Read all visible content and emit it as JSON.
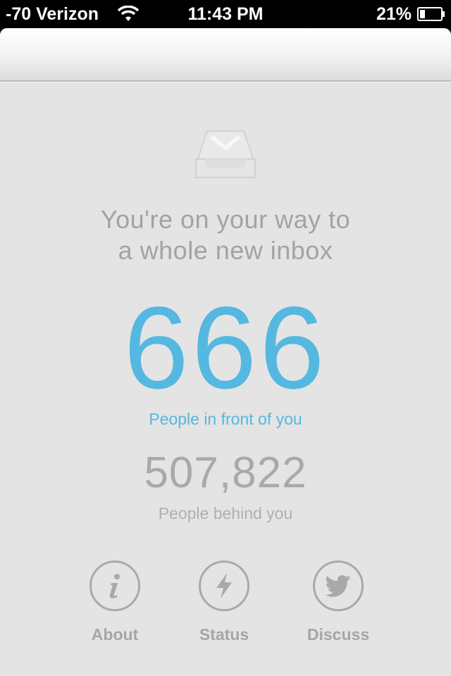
{
  "status_bar": {
    "carrier": "-70 Verizon",
    "time": "11:43 PM",
    "battery_percent": "21%",
    "wifi_icon": "wifi-icon",
    "battery_icon": "battery-icon"
  },
  "main": {
    "logo_icon": "mailbox-tray-icon",
    "tagline_line1": "You're on your way to",
    "tagline_line2": "a whole new inbox",
    "ahead_count": "666",
    "ahead_label": "People in front of you",
    "behind_count": "507,822",
    "behind_label": "People behind you"
  },
  "actions": [
    {
      "label": "About",
      "icon": "info-icon"
    },
    {
      "label": "Status",
      "icon": "lightning-icon"
    },
    {
      "label": "Discuss",
      "icon": "twitter-bird-icon"
    }
  ],
  "colors": {
    "accent": "#55b8e0",
    "background": "#e4e4e4",
    "muted_text": "#a3a3a3"
  }
}
